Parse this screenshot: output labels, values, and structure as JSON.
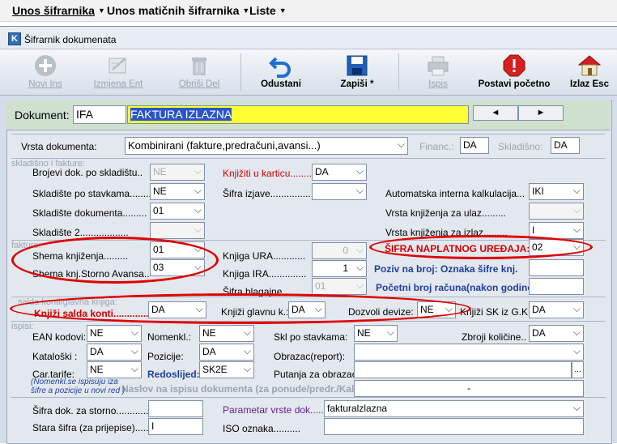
{
  "menu": {
    "items": [
      {
        "label": "Unos šifrarnika"
      },
      {
        "label": "Unos matičnih šifrarnika"
      },
      {
        "label": "Liste"
      }
    ]
  },
  "window": {
    "title": "Šifrarnik dokumenata"
  },
  "toolbar": {
    "novi": "Novi Ins",
    "izmjena": "Izmjena Ent",
    "obrisi": "Obriši Del",
    "odustani": "Odustani",
    "zapisi": "Zapiši *",
    "ispis": "Ispis",
    "postavi": "Postavi početno",
    "izlaz": "Izlaz Esc"
  },
  "document": {
    "label": "Dokument:",
    "code": "IFA",
    "name": "FAKTURA IZLAZNA",
    "prev": "◄",
    "next": "►"
  },
  "vrsta": {
    "label": "Vrsta dokumenta:",
    "value": "Kombinirani (fakture,predračuni,avansi...)",
    "financ_label": "Financ.:",
    "financ_value": "DA",
    "skladisno_label": "Skladišno:",
    "skladisno_value": "DA"
  },
  "skladisno": {
    "section": "skladišno i fakture:",
    "brojevi_label": "Brojevi dok. po skladištu..",
    "brojevi_value": "NE",
    "knjiziti_label": "Knjižiti u karticu.........",
    "knjiziti_value": "DA",
    "skladiste_stavkama_label": "Skladište po stavkama........",
    "skladiste_stavkama_value": "NE",
    "sifra_izjave_label": "Šifra izjave...............",
    "sifra_izjave_value": "",
    "auto_kalk_label": "Automatska interna kalkulacija...",
    "auto_kalk_value": "IKI",
    "skladiste_dok_label": "Skladište dokumenta.........",
    "skladiste_dok_value": "01",
    "vrsta_ulaz_label": "Vrsta knjiženja za ulaz.........",
    "vrsta_ulaz_value": "",
    "skladiste2_label": "Skladište 2..................",
    "skladiste2_value": "",
    "vrsta_izlaz_label": "Vrsta knjiženja za izlaz.........",
    "vrsta_izlaz_value": "I"
  },
  "fakture": {
    "section": "fakture:",
    "shema_label": "Shema knjiženja.........",
    "shema_value": "01",
    "shema_storno_label": "Shema knj.Storno Avansa..",
    "shema_storno_value": "03",
    "knjiga_ura_label": "Knjiga URA............",
    "knjiga_ura_value": "0",
    "knjiga_ira_label": "Knjiga IRA..............",
    "knjiga_ira_value": "1",
    "sifra_blag_label": "Šifra blagajne.......",
    "sifra_blag_value": "01",
    "naplatni_label": "ŠIFRA NAPLATNOG UREĐAJA:",
    "naplatni_value": "02",
    "poziv_label": "Poziv na broj: Oznaka šifre knj.",
    "poziv_value": "",
    "pocetni_label": "Početni broj računa(nakon godine)",
    "pocetni_value": ""
  },
  "salda": {
    "section": "salda konti/glavna knjiga:",
    "knjizi_salda_label": "Knjiži salda konti.............:",
    "knjizi_salda_value": "DA",
    "knjizi_glavnu_label": "Knjiži glavnu k.:",
    "knjizi_glavnu_value": "DA",
    "devize_label": "Dozvoli devize:",
    "devize_value": "NE",
    "sk_gk_label": "Knjiži SK iz G.K:",
    "sk_gk_value": "DA"
  },
  "ispisi": {
    "section": "ispisi:",
    "ean_label": "EAN kodovi:",
    "ean_value": "NE",
    "nomenkl_label": "Nomenkl.:",
    "nomenkl_value": "NE",
    "skl_stavkama_label": "Skl po stavkama:",
    "skl_stavkama_value": "NE",
    "zbroji_label": "Zbroji količine..",
    "zbroji_value": "DA",
    "katalogski_label": "Kataloški :",
    "katalogski_value": "DA",
    "pozicije_label": "Pozicije:",
    "pozicije_value": "DA",
    "obrazac_label": "Obrazac(report):",
    "obrazac_value": "",
    "cartarife_label": "Car.tarife:",
    "cartarife_value": "NE",
    "redoslijed_label": "Redoslijed:",
    "redoslijed_value": "SK2E",
    "putanja_label": "Putanja za obrazac",
    "putanja_value": "",
    "putanja_btn": "...",
    "note": "(Nomenkl.se ispisuju iza šifre a pozicije u novi red )",
    "naslov_label": "Naslov na ispisu dokumenta (za ponude/predr./Kalk):",
    "naslov_value": "-"
  },
  "ostalo": {
    "storno_label": "Šifra dok. za storno.............",
    "storno_value": "",
    "stara_label": "Stara šifra (za prijepise).....",
    "stara_value": "I",
    "parametar_label": "Parametar vrste dok.........",
    "parametar_value": "fakturalzlazna",
    "iso_label": "ISO oznaka..........",
    "iso_value": ""
  }
}
